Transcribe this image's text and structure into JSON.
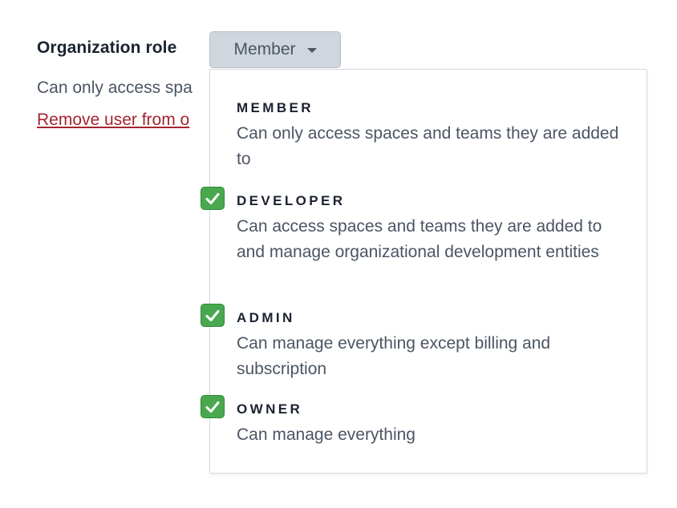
{
  "organization_role": {
    "label": "Organization role",
    "selected_value": "Member",
    "helper_text": "Can only access spa",
    "remove_link": "Remove user from o"
  },
  "dropdown": {
    "options": [
      {
        "title": "MEMBER",
        "description": "Can only access spaces and teams they are added to",
        "checked": false
      },
      {
        "title": "DEVELOPER",
        "description": "Can access spaces and teams they are added to and manage organizational development entities",
        "checked": true
      },
      {
        "title": "ADMIN",
        "description": "Can manage everything except billing and subscription",
        "checked": true
      },
      {
        "title": "OWNER",
        "description": "Can manage everything",
        "checked": true
      }
    ]
  },
  "icons": {
    "check": "white-check-mark-icon",
    "caret": "caret-down-icon"
  },
  "colors": {
    "check_green": "#49a84f",
    "link_red": "#a3262f",
    "select_bg": "#cfd6dd"
  }
}
